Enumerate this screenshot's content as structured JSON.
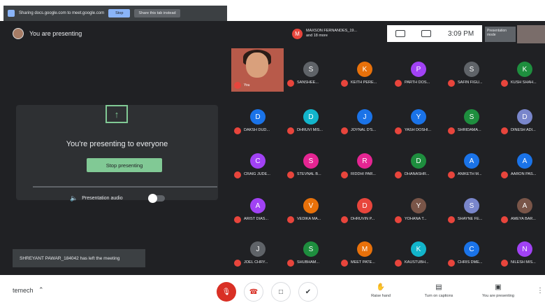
{
  "share_bar": {
    "text": "Sharing docs.google.com to meet.google.com",
    "stop_label": "Stop",
    "hide_label": "Share this tab instead"
  },
  "header": {
    "presenting_title": "You are presenting",
    "chip_initial": "M",
    "chip_line1": "MAXSON FERNANDES_19...",
    "chip_line2": "and 18 more",
    "time": "3:09 PM",
    "present_now": "Presentation mode"
  },
  "card": {
    "message": "You're presenting to everyone",
    "stop_label": "Stop presenting",
    "audio_label": "Presentation audio"
  },
  "notice": "SHREYANT PAWAR_184042 has left the meeting",
  "self_tile": {
    "name": "You"
  },
  "participants": [
    {
      "initial": "S",
      "name": "SANSHEE...",
      "color": "#5f6368"
    },
    {
      "initial": "K",
      "name": "KEITH PERE...",
      "color": "#e8710a"
    },
    {
      "initial": "P",
      "name": "PARTH DOS...",
      "color": "#a142f4"
    },
    {
      "initial": "S",
      "name": "SAFIN FIGU...",
      "color": "#5f6368"
    },
    {
      "initial": "K",
      "name": "KUSH SHAH...",
      "color": "#1e8e3e"
    },
    {
      "initial": "D",
      "name": "DAKSH DUD...",
      "color": "#1a73e8"
    },
    {
      "initial": "D",
      "name": "DHRUVI MIS...",
      "color": "#12b5cb"
    },
    {
      "initial": "J",
      "name": "JOYNAL D'S...",
      "color": "#1a73e8"
    },
    {
      "initial": "Y",
      "name": "YASH DOSHI...",
      "color": "#1a73e8"
    },
    {
      "initial": "S",
      "name": "SHRIDAMA...",
      "color": "#1e8e3e"
    },
    {
      "initial": "D",
      "name": "DINESH ADI...",
      "color": "#7986cb"
    },
    {
      "initial": "C",
      "name": "CRAIG JUDE...",
      "color": "#a142f4"
    },
    {
      "initial": "S",
      "name": "STEVNAL B...",
      "color": "#e52592"
    },
    {
      "initial": "R",
      "name": "RIDDHI PAR...",
      "color": "#e52592"
    },
    {
      "initial": "D",
      "name": "DHANASHR...",
      "color": "#1e8e3e"
    },
    {
      "initial": "A",
      "name": "ANIKETH M...",
      "color": "#1a73e8"
    },
    {
      "initial": "A",
      "name": "AARON PAS...",
      "color": "#1a73e8"
    },
    {
      "initial": "A",
      "name": "ARIST DIAS...",
      "color": "#a142f4"
    },
    {
      "initial": "V",
      "name": "VEDIKA MA...",
      "color": "#e8710a"
    },
    {
      "initial": "D",
      "name": "DHRUVIN P...",
      "color": "#e8453c"
    },
    {
      "initial": "Y",
      "name": "YOHANA T...",
      "color": "#795548"
    },
    {
      "initial": "S",
      "name": "SHAYNE FE...",
      "color": "#7986cb"
    },
    {
      "initial": "A",
      "name": "AMEYA BAR...",
      "color": "#795548"
    },
    {
      "initial": "J",
      "name": "JOEL CHRY...",
      "color": "#5f6368"
    },
    {
      "initial": "S",
      "name": "SHUBHAM...",
      "color": "#1e8e3e"
    },
    {
      "initial": "M",
      "name": "MEET PATE...",
      "color": "#e8710a"
    },
    {
      "initial": "K",
      "name": "KAUSTUBH...",
      "color": "#12b5cb"
    },
    {
      "initial": "C",
      "name": "CHRIS DME...",
      "color": "#1a73e8"
    },
    {
      "initial": "N",
      "name": "NILESH MIS...",
      "color": "#a142f4"
    }
  ],
  "bottom": {
    "meeting_code": "temech",
    "raise_hand": "Raise hand",
    "captions": "Turn on captions",
    "presenting": "You are presenting"
  }
}
